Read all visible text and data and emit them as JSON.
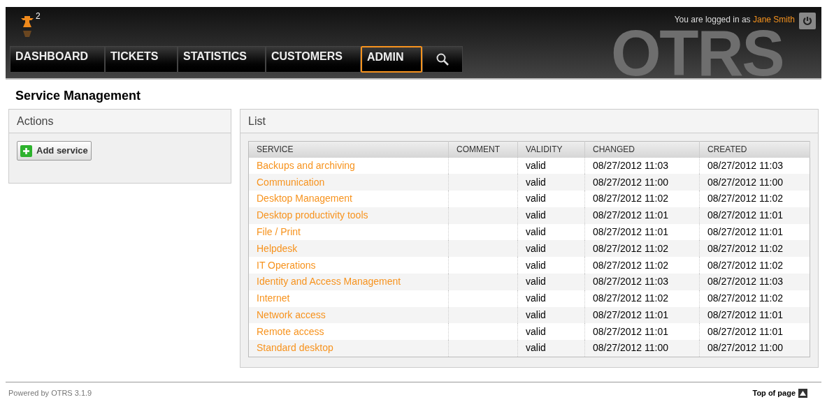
{
  "header": {
    "badge": "2",
    "logo_text": "OTRS",
    "login_prefix": "You are logged in as",
    "user": "Jane Smith"
  },
  "nav": [
    {
      "label": "DASHBOARD",
      "selected": false
    },
    {
      "label": "TICKETS",
      "selected": false
    },
    {
      "label": "STATISTICS",
      "selected": false
    },
    {
      "label": "CUSTOMERS",
      "selected": false
    },
    {
      "label": "ADMIN",
      "selected": true
    }
  ],
  "page_title": "Service Management",
  "actions": {
    "title": "Actions",
    "button": "Add service"
  },
  "list": {
    "title": "List",
    "columns": [
      "SERVICE",
      "COMMENT",
      "VALIDITY",
      "CHANGED",
      "CREATED"
    ],
    "rows": [
      [
        "Backups and archiving",
        "",
        "valid",
        "08/27/2012 11:03",
        "08/27/2012 11:03"
      ],
      [
        "Communication",
        "",
        "valid",
        "08/27/2012 11:00",
        "08/27/2012 11:00"
      ],
      [
        "Desktop Management",
        "",
        "valid",
        "08/27/2012 11:02",
        "08/27/2012 11:02"
      ],
      [
        "Desktop productivity tools",
        "",
        "valid",
        "08/27/2012 11:01",
        "08/27/2012 11:01"
      ],
      [
        "File / Print",
        "",
        "valid",
        "08/27/2012 11:01",
        "08/27/2012 11:01"
      ],
      [
        "Helpdesk",
        "",
        "valid",
        "08/27/2012 11:02",
        "08/27/2012 11:02"
      ],
      [
        "IT Operations",
        "",
        "valid",
        "08/27/2012 11:02",
        "08/27/2012 11:02"
      ],
      [
        "Identity and Access Management",
        "",
        "valid",
        "08/27/2012 11:03",
        "08/27/2012 11:03"
      ],
      [
        "Internet",
        "",
        "valid",
        "08/27/2012 11:02",
        "08/27/2012 11:02"
      ],
      [
        "Network access",
        "",
        "valid",
        "08/27/2012 11:01",
        "08/27/2012 11:01"
      ],
      [
        "Remote access",
        "",
        "valid",
        "08/27/2012 11:01",
        "08/27/2012 11:01"
      ],
      [
        "Standard desktop",
        "",
        "valid",
        "08/27/2012 11:00",
        "08/27/2012 11:00"
      ]
    ]
  },
  "footer": {
    "powered": "Powered by OTRS 3.1.9",
    "top": "Top of page"
  }
}
